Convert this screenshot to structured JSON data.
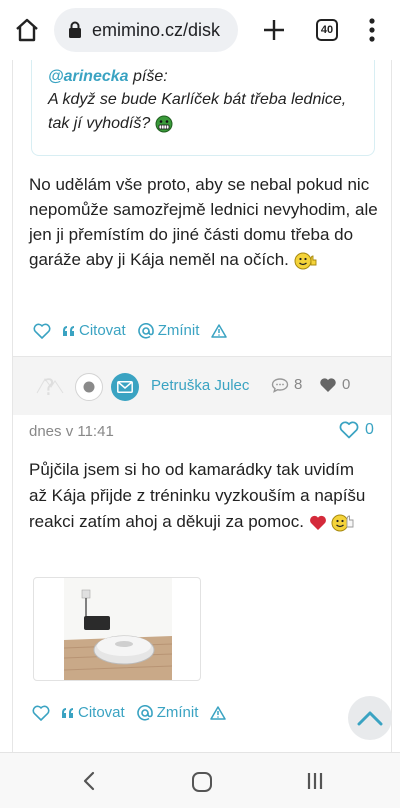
{
  "browser": {
    "url": "emimino.cz/disk",
    "tab_count": "40",
    "icons": [
      "home-icon",
      "lock-icon",
      "plus-icon",
      "tabs-icon",
      "kebab-menu-icon"
    ]
  },
  "post1": {
    "quote": {
      "username": "@arinecka",
      "writes": "píše:",
      "text": "A když se bude Karlíček bát třeba lednice, tak jí vyhodíš?",
      "emoji": "grimace-emoji"
    },
    "text": "No udělám vše proto, aby se nebal pokud nic nepomůže samozřejmě lednici nevyhodim, ale jen ji přemístím do jiné části domu třeba do garáže aby ji Kája neměl na očích.",
    "emoji": "thumbs-up-emoji",
    "actions": {
      "cite": "Citovat",
      "mention": "Zmínit"
    }
  },
  "post2": {
    "author": "Petruška Julec",
    "comment_count": "8",
    "heart_count": "0",
    "date": "dnes v 11:41",
    "likes": "0",
    "text": "Půjčila jsem si ho od kamarádky tak uvidím až Kája přijde z tréninku vyzkouším a napíšu reakci zatím ahoj a děkuji za pomoc.",
    "emojis": [
      "red-heart-emoji",
      "thumbs-up-emoji"
    ],
    "image": "robot-vacuum-photo",
    "actions": {
      "cite": "Citovat",
      "mention": "Zmínit"
    }
  },
  "colors": {
    "accent": "#3aa3c2",
    "header_bg": "#f4f4f4",
    "muted": "#888888"
  },
  "navbar": {
    "icons": [
      "back-icon",
      "home-button-icon",
      "recents-icon"
    ]
  }
}
